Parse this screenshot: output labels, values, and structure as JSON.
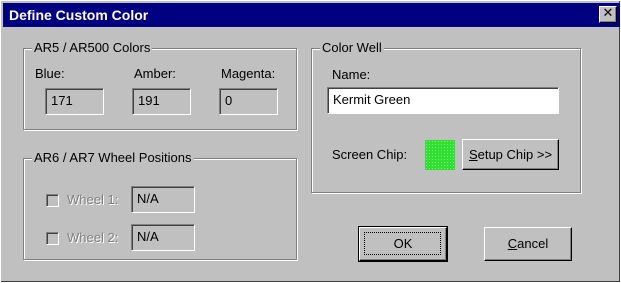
{
  "window": {
    "title": "Define Custom Color",
    "close_glyph": "✕"
  },
  "ar5_group": {
    "legend": "AR5 / AR500 Colors",
    "blue": {
      "label": "Blue:",
      "value": "171"
    },
    "amber": {
      "label": "Amber:",
      "value": "191"
    },
    "magenta": {
      "label": "Magenta:",
      "value": "0"
    }
  },
  "ar6_group": {
    "legend": "AR6 / AR7 Wheel Positions",
    "wheel1": {
      "label": "Wheel 1:",
      "value": "N/A",
      "checked": false,
      "enabled": false
    },
    "wheel2": {
      "label": "Wheel 2:",
      "value": "N/A",
      "checked": false,
      "enabled": false
    }
  },
  "color_well": {
    "legend": "Color Well",
    "name_label": "Name:",
    "name_value": "Kermit Green",
    "screen_chip_label": "Screen Chip:",
    "chip_color": "#33dd33",
    "setup_chip": {
      "mnemonic": "S",
      "rest": "etup Chip >>"
    }
  },
  "buttons": {
    "ok": {
      "label": "OK"
    },
    "cancel": {
      "mnemonic": "C",
      "rest": "ancel"
    }
  },
  "icons": {
    "close": "close-icon"
  }
}
